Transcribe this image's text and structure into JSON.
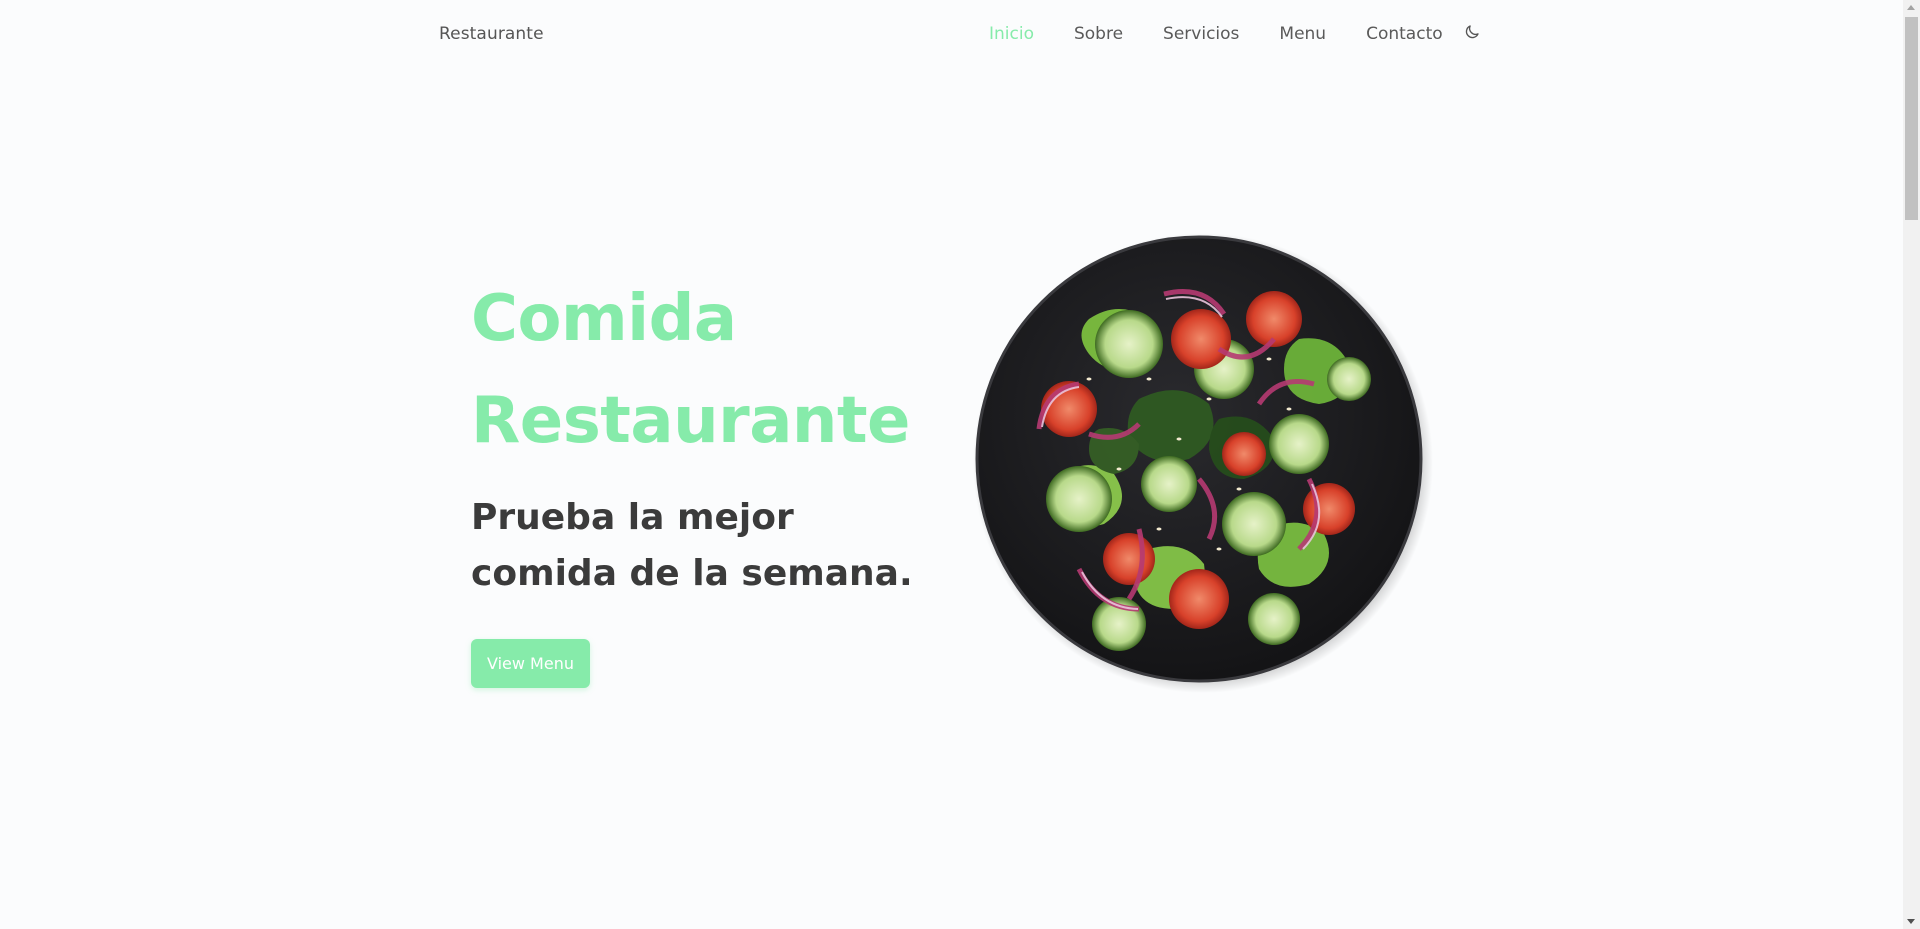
{
  "header": {
    "brand": "Restaurante",
    "nav": [
      {
        "label": "Inicio",
        "active": true
      },
      {
        "label": "Sobre",
        "active": false
      },
      {
        "label": "Servicios",
        "active": false
      },
      {
        "label": "Menu",
        "active": false
      },
      {
        "label": "Contacto",
        "active": false
      }
    ],
    "theme_toggle_icon": "moon-icon"
  },
  "hero": {
    "title_line1": "Comida",
    "title_line2": "Restaurante",
    "subtitle": "Prueba la mejor comida de la semana.",
    "button_label": "View Menu",
    "image": "salad-plate-image"
  },
  "colors": {
    "accent": "#86ebaa",
    "text_dark": "#3b3b3b",
    "background": "#fbfcfd"
  }
}
